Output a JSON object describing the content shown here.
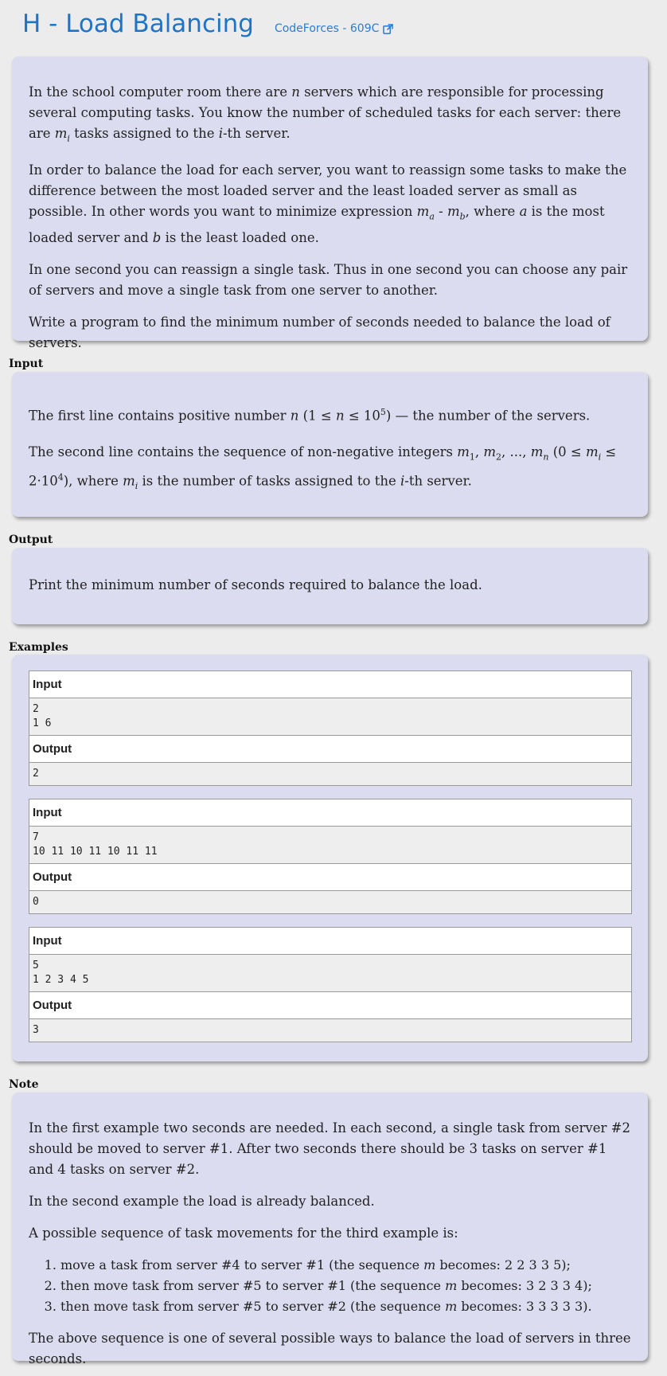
{
  "header": {
    "title": "H - Load Balancing",
    "source": "CodeForces - 609C"
  },
  "statement": {
    "p1_a": "In the school computer room there are ",
    "p1_n": "n",
    "p1_b": " servers which are responsible for processing several computing tasks. You know the number of scheduled tasks for each server: there are ",
    "p1_m": "m",
    "p1_i": "i",
    "p1_c": " tasks assigned to the ",
    "p1_i2": "i",
    "p1_d": "-th server.",
    "p2_a": "In order to balance the load for each server, you want to reassign some tasks to make the difference between the most loaded server and the least loaded server as small as possible. In other words you want to minimize expression ",
    "p2_ma": "m",
    "p2_a_sub": "a",
    "p2_minus": " - ",
    "p2_mb": "m",
    "p2_b_sub": "b",
    "p2_b": ", where ",
    "p2_avar": "a",
    "p2_c": " is the most loaded server and ",
    "p2_bvar": "b",
    "p2_d": " is the least loaded one.",
    "p3": "In one second you can reassign a single task. Thus in one second you can choose any pair of servers and move a single task from one server to another.",
    "p4": "Write a program to find the minimum number of seconds needed to balance the load of servers."
  },
  "input_section": {
    "label": "Input",
    "p1_a": "The first line contains positive number ",
    "p1_n": "n",
    "p1_range": " (1 ≤ ",
    "p1_n2": "n",
    "p1_range2": " ≤ 10",
    "p1_exp": "5",
    "p1_b": ") — the number of the servers.",
    "p2_a": "The second line contains the sequence of non-negative integers ",
    "p2_m1": "m",
    "p2_s1": "1",
    "p2_comma1": ", ",
    "p2_m2": "m",
    "p2_s2": "2",
    "p2_dots": ", ..., ",
    "p2_mn": "m",
    "p2_sn": "n",
    "p2_range": " (0 ≤ ",
    "p2_mi": "m",
    "p2_si": "i",
    "p2_range2": " ≤ 2·10",
    "p2_exp": "4",
    "p2_b": "), where ",
    "p2_mi2": "m",
    "p2_si2": "i",
    "p2_c": " is the number of tasks assigned to the ",
    "p2_i": "i",
    "p2_d": "-th server."
  },
  "output_section": {
    "label": "Output",
    "p1": "Print the minimum number of seconds required to balance the load."
  },
  "examples": {
    "label": "Examples",
    "items": [
      {
        "input_label": "Input",
        "input": "2\n1 6",
        "output_label": "Output",
        "output": "2"
      },
      {
        "input_label": "Input",
        "input": "7\n10 11 10 11 10 11 11",
        "output_label": "Output",
        "output": "0"
      },
      {
        "input_label": "Input",
        "input": "5\n1 2 3 4 5",
        "output_label": "Output",
        "output": "3"
      }
    ]
  },
  "note": {
    "label": "Note",
    "p1": "In the first example two seconds are needed. In each second, a single task from server #2 should be moved to server #1. After two seconds there should be 3 tasks on server #1 and 4 tasks on server #2.",
    "p2": "In the second example the load is already balanced.",
    "p3": "A possible sequence of task movements for the third example is:",
    "list": [
      {
        "a": "move a task from server #4 to server #1 (the sequence ",
        "m": "m",
        "b": " becomes: 2 2 3 3 5);"
      },
      {
        "a": "then move task from server #5 to server #1 (the sequence ",
        "m": "m",
        "b": " becomes: 3 2 3 3 4);"
      },
      {
        "a": "then move task from server #5 to server #2 (the sequence ",
        "m": "m",
        "b": " becomes: 3 3 3 3 3)."
      }
    ],
    "p4": "The above sequence is one of several possible ways to balance the load of servers in three seconds."
  }
}
